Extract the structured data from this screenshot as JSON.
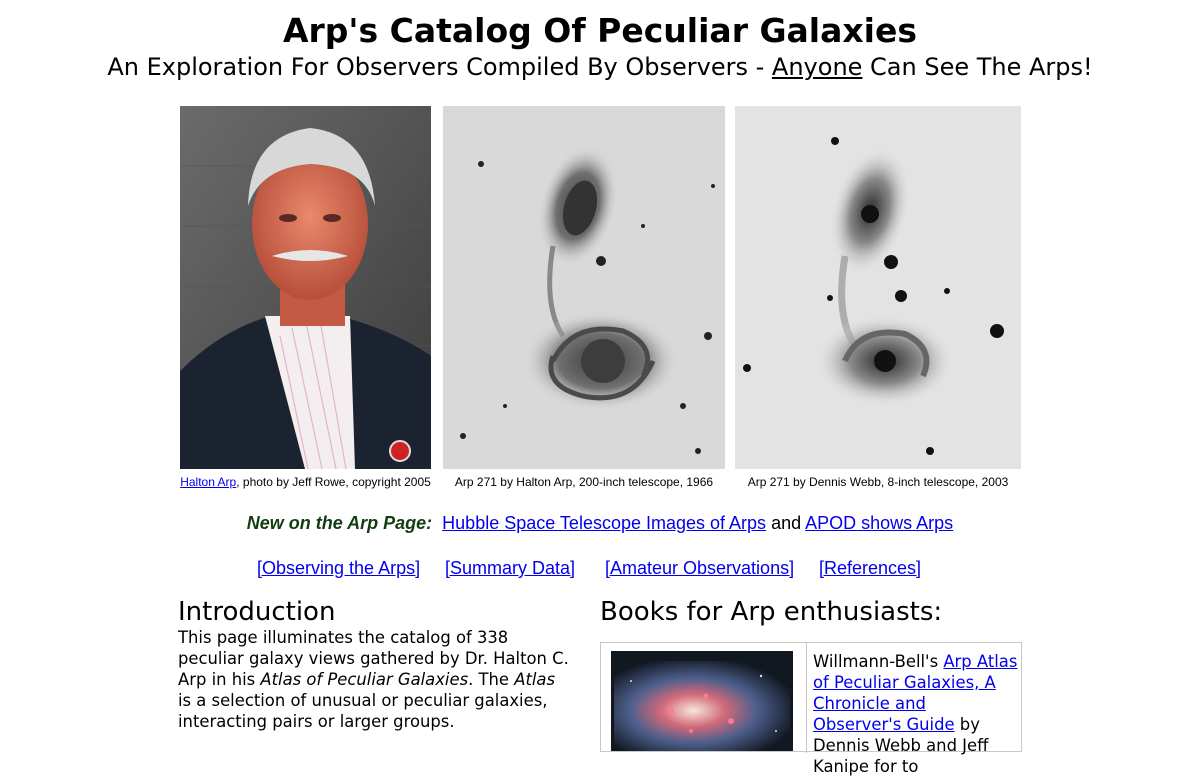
{
  "header": {
    "title": "Arp's Catalog Of Peculiar Galaxies",
    "subtitle_before": "An Exploration For Observers Compiled By Observers - ",
    "subtitle_underlined": "Anyone",
    "subtitle_after": " Can See The Arps!"
  },
  "photos": [
    {
      "caption_link": "Halton Arp",
      "caption_text": ", photo by Jeff Rowe, copyright 2005"
    },
    {
      "caption_text": "Arp 271 by Halton Arp, 200-inch telescope, 1966"
    },
    {
      "caption_text": "Arp 271 by Dennis Webb,  8-inch telescope,  2003"
    }
  ],
  "news": {
    "label": "New on the Arp Page:",
    "link1": "Hubble Space Telescope Images of Arps",
    "conjunction": "and",
    "link2": "APOD shows Arps"
  },
  "nav": {
    "items": [
      "[Observing the Arps]",
      "[Summary Data]",
      "[Amateur Observations]",
      "[References]"
    ]
  },
  "intro": {
    "heading": "Introduction",
    "text_1": "This page illuminates the catalog of 338 peculiar galaxy views gathered by Dr. Halton C. Arp in his ",
    "italic_1": "Atlas of Peculiar Galaxies",
    "text_2": ". The ",
    "italic_2": "Atlas",
    "text_3": " is a selection of unusual or peculiar galaxies, interacting pairs or larger groups."
  },
  "books": {
    "heading": "Books for Arp enthusiasts:",
    "publisher": "Willmann-Bell's ",
    "book_link": "Arp Atlas of Peculiar Galaxies, A Chronicle and Observer's Guide",
    "authors": " by Dennis Webb and Jeff Kanipe for to"
  }
}
